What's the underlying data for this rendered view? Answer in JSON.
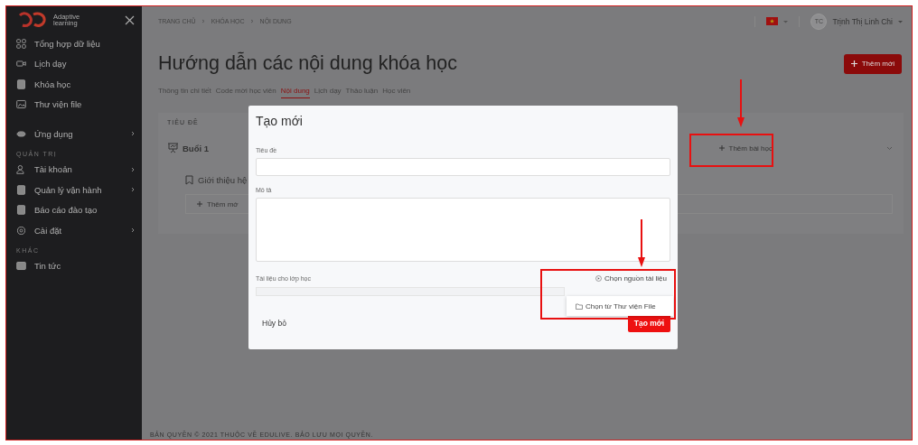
{
  "sidebar": {
    "logo_lines": [
      "Adaptive",
      "learning"
    ],
    "items": [
      {
        "kind": "item",
        "label": "Tổng hợp dữ liệu",
        "has_submenu": false
      },
      {
        "kind": "item",
        "label": "Lịch dạy",
        "has_submenu": false
      },
      {
        "kind": "item",
        "label": "Khóa học",
        "has_submenu": false
      },
      {
        "kind": "item",
        "label": "Thư viện file",
        "has_submenu": false
      },
      {
        "kind": "item",
        "label": "Ứng dụng",
        "has_submenu": true
      },
      {
        "kind": "section",
        "label": "QUẢN TRỊ"
      },
      {
        "kind": "item",
        "label": "Tài khoản",
        "has_submenu": true
      },
      {
        "kind": "item",
        "label": "Quản lý vận hành",
        "has_submenu": true
      },
      {
        "kind": "item",
        "label": "Báo cáo đào tạo",
        "has_submenu": false
      },
      {
        "kind": "item",
        "label": "Cài đặt",
        "has_submenu": true
      },
      {
        "kind": "section",
        "label": "KHÁC"
      },
      {
        "kind": "item",
        "label": "Tin tức",
        "has_submenu": false
      }
    ]
  },
  "header": {
    "breadcrumb": [
      "TRANG CHỦ",
      "KHÓA HỌC",
      "NỘI DUNG"
    ],
    "user": {
      "initials": "TC",
      "name": "Trịnh Thị Linh Chi"
    }
  },
  "page": {
    "title": "Hướng dẫn các nội dung khóa học",
    "add_button": "Thêm mới",
    "tabs": [
      {
        "label": "Thông tin chi tiết",
        "selected": false
      },
      {
        "label": "Code mời học viên",
        "selected": false
      },
      {
        "label": "Nội dung",
        "selected": true
      },
      {
        "label": "Lịch dạy",
        "selected": false
      },
      {
        "label": "Thảo luận",
        "selected": false
      },
      {
        "label": "Học viên",
        "selected": false
      }
    ],
    "content": {
      "column_header": "TIÊU ĐỀ",
      "sessions": [
        {
          "title": "Buổi 1",
          "add_lesson": "Thêm bài học",
          "expanded": true,
          "lessons": [
            {
              "title": "Giới thiệu hệ"
            }
          ],
          "add_item": "Thêm mớ"
        }
      ]
    }
  },
  "modal": {
    "title": "Tạo mới",
    "fields": [
      {
        "kind": "input",
        "label": "Tiêu đề"
      },
      {
        "kind": "textarea",
        "label": "Mô tả"
      }
    ],
    "attachment": {
      "label": "Tài liệu cho lớp học",
      "source_button": "Chọn nguồn tài liệu",
      "menu_items": [
        "Chọn từ Thư viện File"
      ]
    },
    "cancel": "Hủy bỏ",
    "submit": "Tạo mới"
  },
  "footer": {
    "copyright": "BẢN QUYỀN © 2021 THUỘC VỀ EDULIVE. BẢO LƯU MỌI QUYỀN."
  }
}
